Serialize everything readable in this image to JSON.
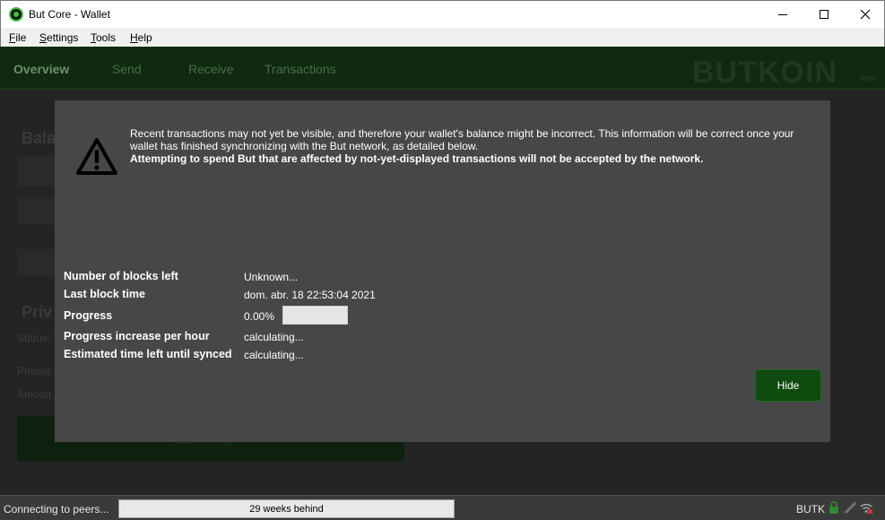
{
  "window": {
    "title": "But Core - Wallet",
    "minimize_icon": "minimize-icon",
    "maximize_icon": "maximize-icon",
    "close_icon": "close-icon"
  },
  "menu": {
    "items": [
      {
        "u": "F",
        "rest": "ile"
      },
      {
        "u": "S",
        "rest": "ettings"
      },
      {
        "u": "T",
        "rest": "ools"
      },
      {
        "u": "H",
        "rest": "elp"
      }
    ]
  },
  "toolbar": {
    "tabs": [
      "Overview",
      "Send",
      "Receive",
      "Transactions"
    ],
    "brand": "BUTKOIN",
    "brand_sub": "eco"
  },
  "background": {
    "balance_title": "Bala",
    "privacy_title": "Priv",
    "status_label": "Status:",
    "private_label": "Private",
    "amount_label": "Amoun",
    "start_button": "Start Mixing"
  },
  "modal": {
    "notice": "Recent transactions may not yet be visible, and therefore your wallet's balance might be incorrect. This information will be correct once your wallet has finished synchronizing with the But network, as detailed below.",
    "notice_strong": "Attempting to spend But that are affected by not-yet-displayed transactions will not be accepted by the network.",
    "rows": [
      {
        "label": "Number of blocks left",
        "value": "Unknown..."
      },
      {
        "label": "Last block time",
        "value": "dom. abr. 18 22:53:04 2021"
      },
      {
        "label": "Progress",
        "value": "0.00%"
      },
      {
        "label": "Progress increase per hour",
        "value": "calculating..."
      },
      {
        "label": "Estimated time left until synced",
        "value": "calculating..."
      }
    ],
    "progress": 0,
    "hide_button": "Hide"
  },
  "statusbar": {
    "status": "Connecting to peers...",
    "sync_text": "29 weeks behind",
    "unit": "BUTK"
  },
  "colors": {
    "accent": "#0f4a0f",
    "toolbar_bg": "#0f2a0f"
  }
}
